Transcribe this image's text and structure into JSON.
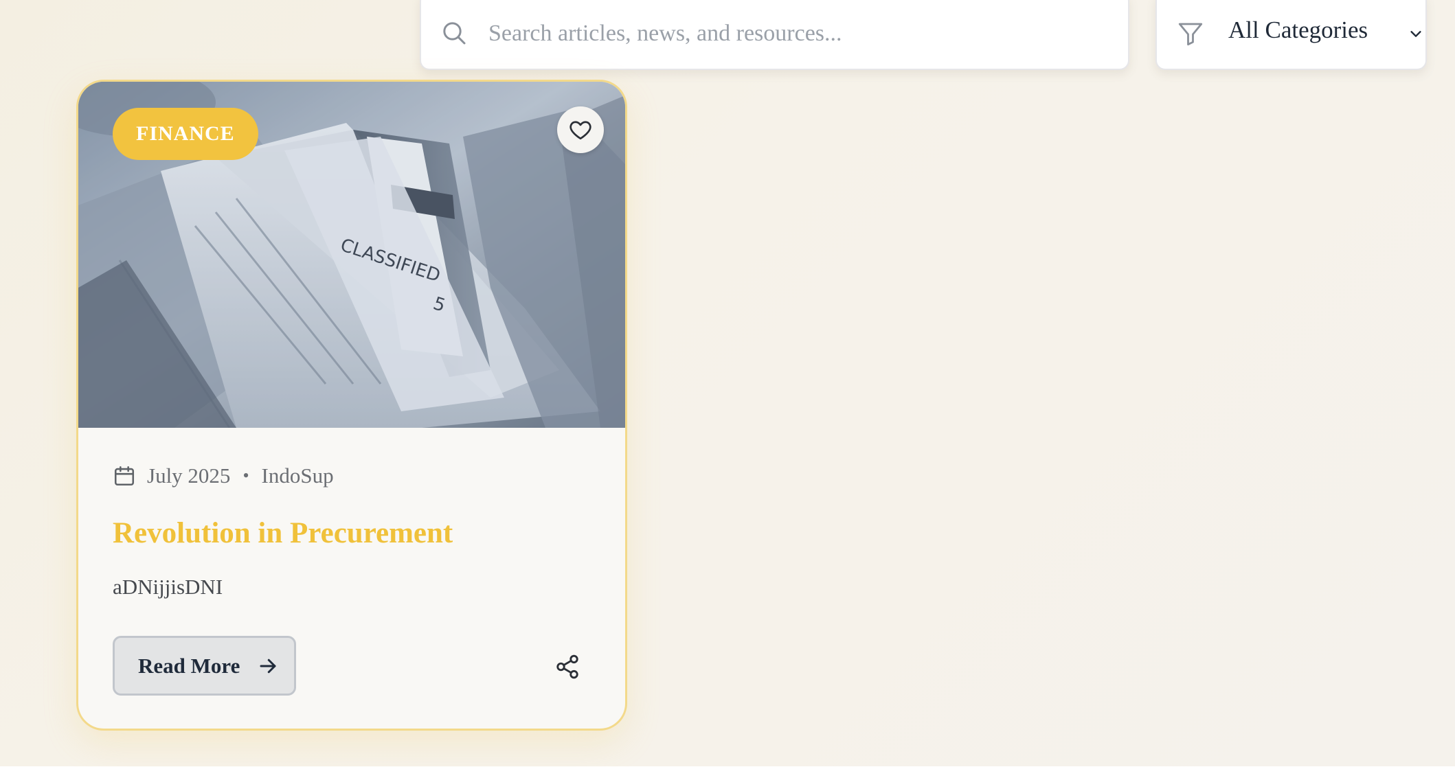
{
  "search": {
    "placeholder": "Search articles, news, and resources...",
    "icon": "search-icon"
  },
  "category_filter": {
    "selected": "All Categories",
    "icon": "filter-icon"
  },
  "card": {
    "category": "FINANCE",
    "image_alt": "classified-folders-photo",
    "date": "July 2025",
    "author": "IndoSup",
    "separator": "•",
    "title": "Revolution in Precurement",
    "excerpt": "aDNijjisDNI",
    "read_more_label": "Read More"
  },
  "colors": {
    "accent": "#f2c33f",
    "title": "#f0c13a",
    "card_border": "#f3d98a",
    "background": "#f5f1e8"
  }
}
